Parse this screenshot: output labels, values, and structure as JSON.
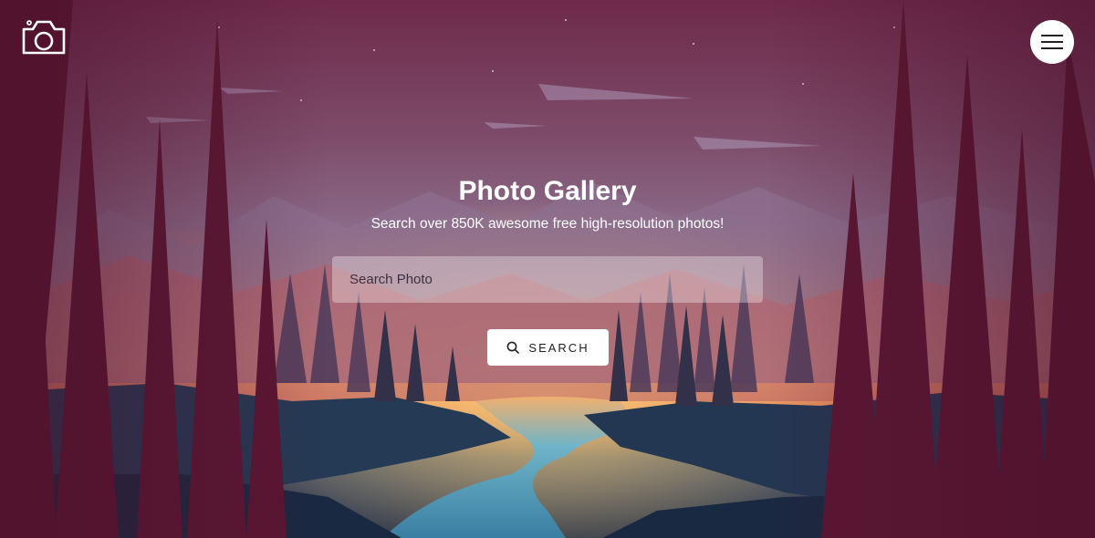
{
  "hero": {
    "title": "Photo Gallery",
    "subtitle": "Search over 850K awesome free high-resolution photos!"
  },
  "search": {
    "placeholder": "Search Photo",
    "value": "",
    "button_label": "SEARCH"
  },
  "header": {
    "logo_icon": "camera-icon",
    "menu_icon": "hamburger-menu-icon"
  },
  "colors": {
    "sky_top": "#7a2f4e",
    "horizon": "#f2a35a",
    "river": "#4fa3c0",
    "button_bg": "#ffffff",
    "text": "#ffffff"
  }
}
